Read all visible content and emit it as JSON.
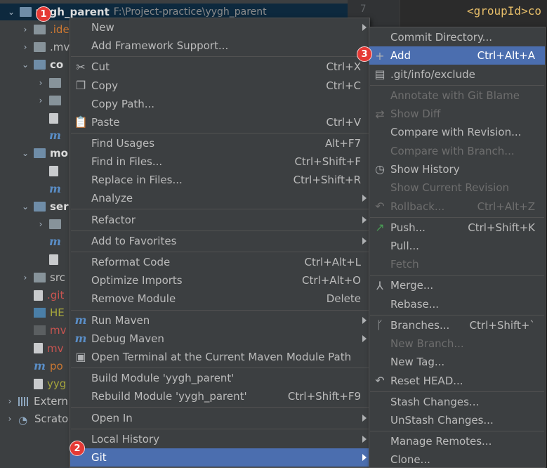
{
  "tree": {
    "root": {
      "label": "yygh_parent",
      "path": "F:\\Project-practice\\yygh_parent"
    },
    "rows": [
      {
        "label": ".ide",
        "icon": "folder-icon",
        "arrow": "right",
        "indent": 1,
        "cls": "orange"
      },
      {
        "label": ".mv",
        "icon": "folder-icon",
        "arrow": "right",
        "indent": 1,
        "cls": ""
      },
      {
        "label": "co",
        "icon": "module-folder-icon",
        "arrow": "down",
        "indent": 1,
        "cls": "bold"
      },
      {
        "label": "",
        "icon": "folder-icon",
        "arrow": "right",
        "indent": 2,
        "cls": ""
      },
      {
        "label": "",
        "icon": "folder-icon",
        "arrow": "right",
        "indent": 2,
        "cls": ""
      },
      {
        "label": "",
        "icon": "file-icon",
        "arrow": "",
        "indent": 2,
        "cls": ""
      },
      {
        "label": "",
        "icon": "maven-icon",
        "arrow": "",
        "indent": 2,
        "cls": ""
      },
      {
        "label": "mo",
        "icon": "module-folder-icon",
        "arrow": "down",
        "indent": 1,
        "cls": "bold"
      },
      {
        "label": "",
        "icon": "file-icon",
        "arrow": "",
        "indent": 2,
        "cls": ""
      },
      {
        "label": "",
        "icon": "maven-icon",
        "arrow": "",
        "indent": 2,
        "cls": ""
      },
      {
        "label": "ser",
        "icon": "module-folder-icon",
        "arrow": "down",
        "indent": 1,
        "cls": "bold"
      },
      {
        "label": "",
        "icon": "folder-icon",
        "arrow": "right",
        "indent": 2,
        "cls": ""
      },
      {
        "label": "",
        "icon": "maven-icon",
        "arrow": "",
        "indent": 2,
        "cls": ""
      },
      {
        "label": "",
        "icon": "file-icon",
        "arrow": "",
        "indent": 2,
        "cls": ""
      },
      {
        "label": "src",
        "icon": "folder-icon",
        "arrow": "right",
        "indent": 1,
        "cls": ""
      },
      {
        "label": ".git",
        "icon": "gitignore-icon",
        "arrow": "",
        "indent": 1,
        "cls": "red"
      },
      {
        "label": "HE",
        "icon": "markdown-icon",
        "arrow": "",
        "indent": 1,
        "cls": "olive"
      },
      {
        "label": "mv",
        "icon": "terminal-icon",
        "arrow": "",
        "indent": 1,
        "cls": "red"
      },
      {
        "label": "mv",
        "icon": "file-icon",
        "arrow": "",
        "indent": 1,
        "cls": "red"
      },
      {
        "label": "po",
        "icon": "maven-icon",
        "arrow": "",
        "indent": 1,
        "cls": "orange"
      },
      {
        "label": "yyg",
        "icon": "file-icon",
        "arrow": "",
        "indent": 1,
        "cls": "olive"
      },
      {
        "label": "Extern",
        "icon": "libraries-icon",
        "arrow": "right",
        "indent": 0,
        "cls": ""
      },
      {
        "label": "Scrato",
        "icon": "scratches-icon",
        "arrow": "right",
        "indent": 0,
        "cls": ""
      }
    ]
  },
  "editor": {
    "line_number": "7",
    "code": "<groupId>co"
  },
  "main_menu": {
    "items": [
      {
        "label": "New",
        "shortcut": "",
        "submenu": true,
        "icon": "",
        "name": "new"
      },
      {
        "label": "Add Framework Support...",
        "shortcut": "",
        "submenu": false,
        "icon": "",
        "name": "add-framework-support"
      },
      {
        "sep": true
      },
      {
        "label": "Cut",
        "shortcut": "Ctrl+X",
        "submenu": false,
        "icon": "✂",
        "name": "cut"
      },
      {
        "label": "Copy",
        "shortcut": "Ctrl+C",
        "submenu": false,
        "icon": "❐",
        "name": "copy"
      },
      {
        "label": "Copy Path...",
        "shortcut": "",
        "submenu": false,
        "icon": "",
        "name": "copy-path"
      },
      {
        "label": "Paste",
        "shortcut": "Ctrl+V",
        "submenu": false,
        "icon": "📋",
        "name": "paste"
      },
      {
        "sep": true
      },
      {
        "label": "Find Usages",
        "shortcut": "Alt+F7",
        "submenu": false,
        "icon": "",
        "name": "find-usages"
      },
      {
        "label": "Find in Files...",
        "shortcut": "Ctrl+Shift+F",
        "submenu": false,
        "icon": "",
        "name": "find-in-files"
      },
      {
        "label": "Replace in Files...",
        "shortcut": "Ctrl+Shift+R",
        "submenu": false,
        "icon": "",
        "name": "replace-in-files"
      },
      {
        "label": "Analyze",
        "shortcut": "",
        "submenu": true,
        "icon": "",
        "name": "analyze"
      },
      {
        "sep": true
      },
      {
        "label": "Refactor",
        "shortcut": "",
        "submenu": true,
        "icon": "",
        "name": "refactor"
      },
      {
        "sep": true
      },
      {
        "label": "Add to Favorites",
        "shortcut": "",
        "submenu": true,
        "icon": "",
        "name": "add-to-favorites"
      },
      {
        "sep": true
      },
      {
        "label": "Reformat Code",
        "shortcut": "Ctrl+Alt+L",
        "submenu": false,
        "icon": "",
        "name": "reformat-code"
      },
      {
        "label": "Optimize Imports",
        "shortcut": "Ctrl+Alt+O",
        "submenu": false,
        "icon": "",
        "name": "optimize-imports"
      },
      {
        "label": "Remove Module",
        "shortcut": "Delete",
        "submenu": false,
        "icon": "",
        "name": "remove-module"
      },
      {
        "sep": true
      },
      {
        "label": "Run Maven",
        "shortcut": "",
        "submenu": true,
        "icon": "m",
        "name": "run-maven"
      },
      {
        "label": "Debug Maven",
        "shortcut": "",
        "submenu": true,
        "icon": "m",
        "name": "debug-maven"
      },
      {
        "label": "Open Terminal at the Current Maven Module Path",
        "shortcut": "",
        "submenu": false,
        "icon": "▣",
        "name": "open-terminal"
      },
      {
        "sep": true
      },
      {
        "label": "Build Module 'yygh_parent'",
        "shortcut": "",
        "submenu": false,
        "icon": "",
        "name": "build-module"
      },
      {
        "label": "Rebuild Module 'yygh_parent'",
        "shortcut": "Ctrl+Shift+F9",
        "submenu": false,
        "icon": "",
        "name": "rebuild-module"
      },
      {
        "sep": true
      },
      {
        "label": "Open In",
        "shortcut": "",
        "submenu": true,
        "icon": "",
        "name": "open-in"
      },
      {
        "sep": true
      },
      {
        "label": "Local History",
        "shortcut": "",
        "submenu": true,
        "icon": "",
        "name": "local-history"
      },
      {
        "label": "Git",
        "shortcut": "",
        "submenu": true,
        "icon": "",
        "name": "git",
        "highlight": true
      }
    ]
  },
  "git_menu": {
    "items": [
      {
        "label": "Commit Directory...",
        "shortcut": "",
        "icon": "",
        "name": "commit-directory"
      },
      {
        "label": "Add",
        "shortcut": "Ctrl+Alt+A",
        "icon": "+",
        "name": "add",
        "highlight": true
      },
      {
        "label": ".git/info/exclude",
        "shortcut": "",
        "icon": "▤",
        "name": "git-info-exclude"
      },
      {
        "sep": true
      },
      {
        "label": "Annotate with Git Blame",
        "shortcut": "",
        "icon": "",
        "name": "annotate-git-blame",
        "disabled": true
      },
      {
        "label": "Show Diff",
        "shortcut": "",
        "icon": "⇄",
        "name": "show-diff",
        "disabled": true
      },
      {
        "label": "Compare with Revision...",
        "shortcut": "",
        "icon": "",
        "name": "compare-with-revision"
      },
      {
        "label": "Compare with Branch...",
        "shortcut": "",
        "icon": "",
        "name": "compare-with-branch",
        "disabled": true
      },
      {
        "label": "Show History",
        "shortcut": "",
        "icon": "◷",
        "name": "show-history"
      },
      {
        "label": "Show Current Revision",
        "shortcut": "",
        "icon": "",
        "name": "show-current-revision",
        "disabled": true
      },
      {
        "label": "Rollback...",
        "shortcut": "Ctrl+Alt+Z",
        "icon": "↶",
        "name": "rollback",
        "disabled": true
      },
      {
        "sep": true
      },
      {
        "label": "Push...",
        "shortcut": "Ctrl+Shift+K",
        "icon": "↗",
        "name": "push",
        "icon_color": "#499c54"
      },
      {
        "label": "Pull...",
        "shortcut": "",
        "icon": "",
        "name": "pull"
      },
      {
        "label": "Fetch",
        "shortcut": "",
        "icon": "",
        "name": "fetch",
        "disabled": true
      },
      {
        "sep": true
      },
      {
        "label": "Merge...",
        "shortcut": "",
        "icon": "⅄",
        "name": "merge"
      },
      {
        "label": "Rebase...",
        "shortcut": "",
        "icon": "",
        "name": "rebase"
      },
      {
        "sep": true
      },
      {
        "label": "Branches...",
        "shortcut": "Ctrl+Shift+`",
        "icon": "ᚴ",
        "name": "branches"
      },
      {
        "label": "New Branch...",
        "shortcut": "",
        "icon": "",
        "name": "new-branch",
        "disabled": true
      },
      {
        "label": "New Tag...",
        "shortcut": "",
        "icon": "",
        "name": "new-tag"
      },
      {
        "label": "Reset HEAD...",
        "shortcut": "",
        "icon": "↶",
        "name": "reset-head"
      },
      {
        "sep": true
      },
      {
        "label": "Stash Changes...",
        "shortcut": "",
        "icon": "",
        "name": "stash-changes"
      },
      {
        "label": "UnStash Changes...",
        "shortcut": "",
        "icon": "",
        "name": "unstash-changes"
      },
      {
        "sep": true
      },
      {
        "label": "Manage Remotes...",
        "shortcut": "",
        "icon": "",
        "name": "manage-remotes"
      },
      {
        "label": "Clone...",
        "shortcut": "",
        "icon": "",
        "name": "clone"
      }
    ]
  },
  "badges": [
    "1",
    "2",
    "3"
  ],
  "colors": {
    "highlight": "#4b6eaf",
    "menu_bg": "#3c3f41",
    "badge": "#e53935"
  }
}
